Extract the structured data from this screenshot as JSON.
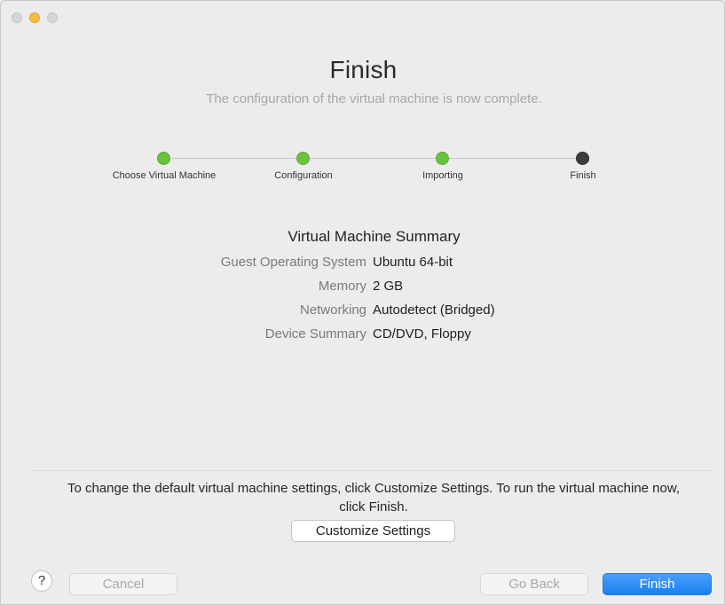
{
  "window": {
    "title": "Finish",
    "subtitle": "The configuration of the virtual machine is now complete."
  },
  "steps": [
    {
      "label": "Choose Virtual Machine",
      "status": "done"
    },
    {
      "label": "Configuration",
      "status": "done"
    },
    {
      "label": "Importing",
      "status": "done"
    },
    {
      "label": "Finish",
      "status": "current"
    }
  ],
  "summary": {
    "heading": "Virtual Machine Summary",
    "rows": [
      {
        "key": "Guest Operating System",
        "value": "Ubuntu 64-bit"
      },
      {
        "key": "Memory",
        "value": "2 GB"
      },
      {
        "key": "Networking",
        "value": "Autodetect (Bridged)"
      },
      {
        "key": "Device Summary",
        "value": "CD/DVD, Floppy"
      }
    ]
  },
  "hint": "To change the default virtual machine settings, click Customize Settings. To run the virtual machine now, click Finish.",
  "buttons": {
    "customize": "Customize Settings",
    "cancel": "Cancel",
    "back": "Go Back",
    "finish": "Finish",
    "help": "?"
  },
  "colors": {
    "step_done": "#6ac33f",
    "step_current": "#3c3c3c",
    "accent": "#1a7ef1"
  }
}
